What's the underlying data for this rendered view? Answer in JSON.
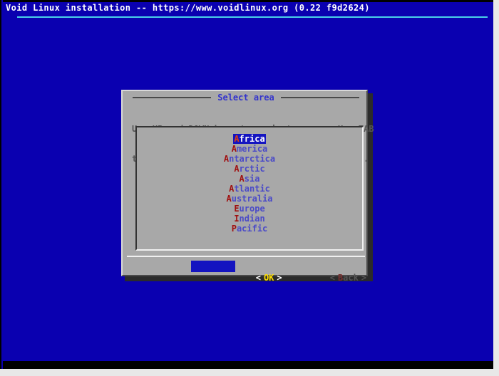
{
  "window": {
    "title": "Void Linux installation -- https://www.voidlinux.org (0.22 f9d2624)",
    "background_color": "#0a00b0",
    "rule_color": "#4ad0e8"
  },
  "dialog": {
    "title": "Select area",
    "prompt_line_1": "Use UP and DOWN keys to navigate menus. Use TAB",
    "prompt_line_2": "to switch between buttons and ENTER to select.",
    "background_color": "#a8a8a8",
    "title_color": "#3333cc",
    "highlight_color": "#1414c0"
  },
  "list": {
    "selected_index": 0,
    "items": [
      {
        "hotkey": "A",
        "rest": "frica",
        "label": "Africa"
      },
      {
        "hotkey": "A",
        "rest": "merica",
        "label": "America"
      },
      {
        "hotkey": "A",
        "rest": "ntarctica",
        "label": "Antarctica"
      },
      {
        "hotkey": "A",
        "rest": "rctic",
        "label": "Arctic"
      },
      {
        "hotkey": "A",
        "rest": "sia",
        "label": "Asia"
      },
      {
        "hotkey": "A",
        "rest": "tlantic",
        "label": "Atlantic"
      },
      {
        "hotkey": "A",
        "rest": "ustralia",
        "label": "Australia"
      },
      {
        "hotkey": "E",
        "rest": "urope",
        "label": "Europe"
      },
      {
        "hotkey": "I",
        "rest": "ndian",
        "label": "Indian"
      },
      {
        "hotkey": "P",
        "rest": "acific",
        "label": "Pacific"
      }
    ]
  },
  "buttons": {
    "ok": {
      "left_bracket": "<",
      "label_hot": "O",
      "label_rest": "K",
      "right_bracket": ">",
      "focused": true
    },
    "back": {
      "left_bracket": "<",
      "label_hot": "B",
      "label_rest": "ack",
      "right_bracket": ">",
      "focused": false
    }
  }
}
